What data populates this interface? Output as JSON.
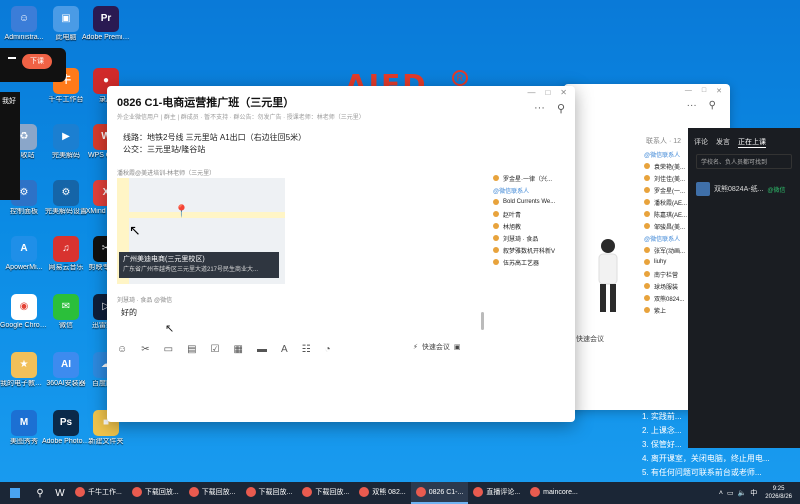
{
  "desktop": {
    "icons": [
      {
        "label": "Administra...",
        "color": "#3b7dd8",
        "glyph": "☺"
      },
      {
        "label": "此电脑",
        "color": "#4a9be6",
        "glyph": "▣"
      },
      {
        "label": "Adobe Premie...",
        "color": "#2a1a52",
        "glyph": "Pr"
      },
      {
        "label": "千牛工作台",
        "color": "#ff7a1a",
        "glyph": "牛"
      },
      {
        "label": "录屏",
        "color": "#d12b2b",
        "glyph": "●"
      },
      {
        "label": "回收站",
        "color": "#8aa6c9",
        "glyph": "♻"
      },
      {
        "label": "完美解码",
        "color": "#1b7fd1",
        "glyph": "▶"
      },
      {
        "label": "WPS Office",
        "color": "#d83b2d",
        "glyph": "W"
      },
      {
        "label": "控制面板",
        "color": "#2d72c7",
        "glyph": "⚙"
      },
      {
        "label": "完美解码设置",
        "color": "#1565a8",
        "glyph": "⚙"
      },
      {
        "label": "XMind Upd...",
        "color": "#e5413a",
        "glyph": "X"
      },
      {
        "label": "ApowerMi...",
        "color": "#1f8fe8",
        "glyph": "A"
      },
      {
        "label": "网易云音乐",
        "color": "#d8332f",
        "glyph": "♫"
      },
      {
        "label": "剪映专业版",
        "color": "#111111",
        "glyph": "✂"
      },
      {
        "label": "Google Chrome",
        "color": "#ffffff",
        "glyph": "◉"
      },
      {
        "label": "微信",
        "color": "#2bbf3a",
        "glyph": "✉"
      },
      {
        "label": "迅雷影音",
        "color": "#0f1f3a",
        "glyph": "▷"
      },
      {
        "label": "我的电子教室学生端",
        "color": "#f1c05a",
        "glyph": "★"
      },
      {
        "label": "360AI安装器",
        "color": "#3d8bef",
        "glyph": "AI"
      },
      {
        "label": "百度网盘",
        "color": "#2d8ae0",
        "glyph": "☁"
      },
      {
        "label": "美图秀秀",
        "color": "#1c70d3",
        "glyph": "M"
      },
      {
        "label": "Adobe Photosh...",
        "color": "#0b2a4a",
        "glyph": "Ps"
      },
      {
        "label": "新建文件夹",
        "color": "#f0c44c",
        "glyph": "■"
      }
    ],
    "overlay_button": "下课",
    "side_label": "我好",
    "logo_text": "AIFD"
  },
  "chat": {
    "title": "0826 C1-电商运营推广班（三元里）",
    "subtitle": "外企业微信用户 | 群主 | 群成员 · 暂不支持 · 群公告：勿发广告 · 授课老师：林老师（三元里）",
    "window_controls": [
      "—",
      "□",
      "✕"
    ],
    "messages": {
      "route_line1": "线路：地铁2号线 三元里站 A1出口（右边往回5米）",
      "route_line2": "公交：三元里站/隆谷站",
      "sender1": "潘秋霞@美进培训-林老师（三元里）",
      "map_title": "广州美迪电商(三元里校区)",
      "map_address": "广东省广州市越秀区三元里大道217号民生商业大...",
      "sender2": "刘慧琦 · 食品  @微信",
      "reply": "好的"
    },
    "toolbar_icons": [
      "smile-icon",
      "scissors-icon",
      "image-icon",
      "doc-icon",
      "check-icon",
      "folder-icon",
      "screen-icon",
      "text-icon",
      "emoji-icon",
      "bubble-icon"
    ],
    "quick_meeting": "快速会议",
    "members": [
      {
        "name": "罗金星·一律（兴... ",
        "group": false
      },
      {
        "name": "@微信联系人",
        "group": true
      },
      {
        "name": "Bold Currents We...",
        "group": false
      },
      {
        "name": "赵叶青",
        "group": false
      },
      {
        "name": "林旭教",
        "group": false
      },
      {
        "name": "刘慧琦 · 食品",
        "group": false
      },
      {
        "name": "叙梦雅数机开科新V",
        "group": false
      },
      {
        "name": "伍苏高工艺器",
        "group": false
      }
    ]
  },
  "back_window": {
    "member_count": "联系人 · 12",
    "members": [
      {
        "name": "@微信联系人",
        "group": true
      },
      {
        "name": "袁荣艳(美...",
        "group": false
      },
      {
        "name": "刘佳佳(美...",
        "group": false
      },
      {
        "name": "罗金星(一...",
        "group": false
      },
      {
        "name": "潘秋霞(AE...",
        "group": false
      },
      {
        "name": "陈嘉琪(AE...",
        "group": false
      },
      {
        "name": "邹骏昌(美...",
        "group": false
      },
      {
        "name": "@微信联系人",
        "group": true
      },
      {
        "name": "张军(动画...",
        "group": false
      },
      {
        "name": "liuhy",
        "group": false
      },
      {
        "name": "南宁栏营",
        "group": false
      },
      {
        "name": "球场服装",
        "group": false
      },
      {
        "name": "双熊0824...",
        "group": false
      },
      {
        "name": "紫上",
        "group": false
      }
    ],
    "meeting": "快速会议"
  },
  "live_panel": {
    "tabs": [
      "评论",
      "发言",
      "正在上课"
    ],
    "search": "学校名、负人员都可找到",
    "item": "双熊0824A-纸...",
    "badge": "@微信"
  },
  "notes": [
    "1. 实践前...",
    "2. 上课念...",
    "3. 保管好...",
    "4. 离开课室，关闭电脑，终止用电...",
    "5. 有任何问题可联系前台或老师..."
  ],
  "taskbar": {
    "items": [
      {
        "label": "千牛工作...",
        "active": false
      },
      {
        "label": "下载回放...",
        "active": false
      },
      {
        "label": "下载回放...",
        "active": false
      },
      {
        "label": "下载回放...",
        "active": false
      },
      {
        "label": "下载回放...",
        "active": false
      },
      {
        "label": "双熊 082...",
        "active": false
      },
      {
        "label": "0826 C1-...",
        "active": true
      },
      {
        "label": "直播评论...",
        "active": false
      },
      {
        "label": "maincore...",
        "active": false
      }
    ],
    "time": "9:25",
    "date": "2026/8/26"
  }
}
